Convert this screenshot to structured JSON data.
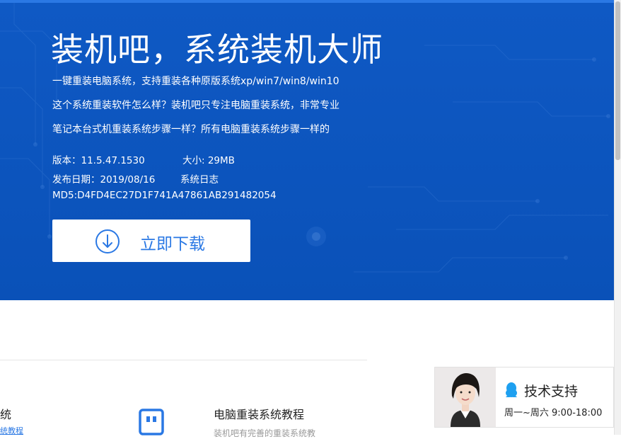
{
  "hero": {
    "title": "装机吧，系统装机大师",
    "desc_lines": [
      "一键重装电脑系统，支持重装各种原版系统xp/win7/win8/win10",
      "这个系统重装软件怎么样？装机吧只专注电脑重装系统，非常专业",
      "笔记本台式机重装系统步骤一样？所有电脑重装系统步骤一样的"
    ],
    "version": "版本：11.5.47.1530",
    "size": "大小: 29MB",
    "release_date": "发布日期：2019/08/16",
    "changelog": "系统日志",
    "md5": "MD5:D4FD4EC27D1F741A47861AB291482054",
    "download_label": "立即下载"
  },
  "lower": {
    "left_fragment": "统",
    "left_link_fragment": "统教程",
    "tutorial_title": "电脑重装系统教程",
    "tutorial_sub": "装机吧有完善的重装系统教"
  },
  "support": {
    "label": "技术支持",
    "hours": "周一~周六 9:00-18:00"
  },
  "colors": {
    "hero_bg": "#0a51b8",
    "accent": "#2a78e4"
  },
  "icons": [
    "download-circle-icon",
    "usb-drive-icon",
    "qq-penguin-icon"
  ]
}
